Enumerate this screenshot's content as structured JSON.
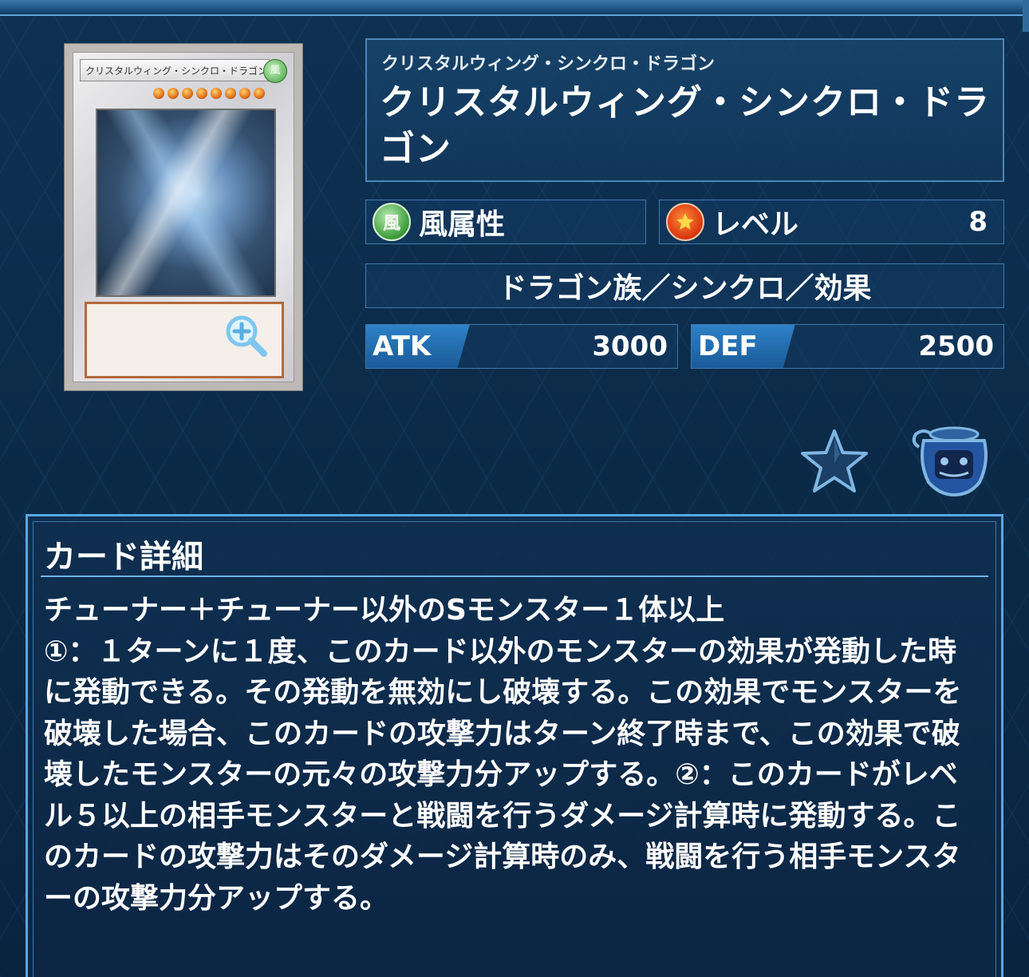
{
  "card": {
    "ruby": "クリスタルウィング・シンクロ・ドラゴン",
    "name": "クリスタルウィング・シンクロ・ドラゴン",
    "thumb_name": "クリスタルウィング・シンクロ・ドラゴン",
    "thumb_attr": "風",
    "attribute_icon": "風",
    "attribute": "風属性",
    "level_label": "レベル",
    "level": "8",
    "level_stars": 8,
    "type_line": "ドラゴン族／シンクロ／効果",
    "atk_label": "ATK",
    "atk": "3000",
    "def_label": "DEF",
    "def": "2500"
  },
  "actions": {
    "favorite_icon": "star-icon",
    "pot_icon": "pot-of-greed-icon",
    "zoom_icon": "zoom-in-icon"
  },
  "detail": {
    "heading": "カード詳細",
    "text": "チューナー＋チューナー以外のSモンスター１体以上\n①：１ターンに１度、このカード以外のモンスターの効果が発動した時に発動できる。その発動を無効にし破壊する。この効果でモンスターを破壊した場合、このカードの攻撃力はターン終了時まで、この効果で破壊したモンスターの元々の攻撃力分アップする。②：このカードがレベル５以上の相手モンスターと戦闘を行うダメージ計算時に発動する。このカードの攻撃力はそのダメージ計算時のみ、戦闘を行う相手モンスターの攻撃力分アップする。"
  },
  "colors": {
    "background": "#0b2a48",
    "panel_border": "#4b86b7",
    "stat_label": "#2e82c8",
    "wind_green": "#3a9a38",
    "level_red": "#d8340e"
  }
}
